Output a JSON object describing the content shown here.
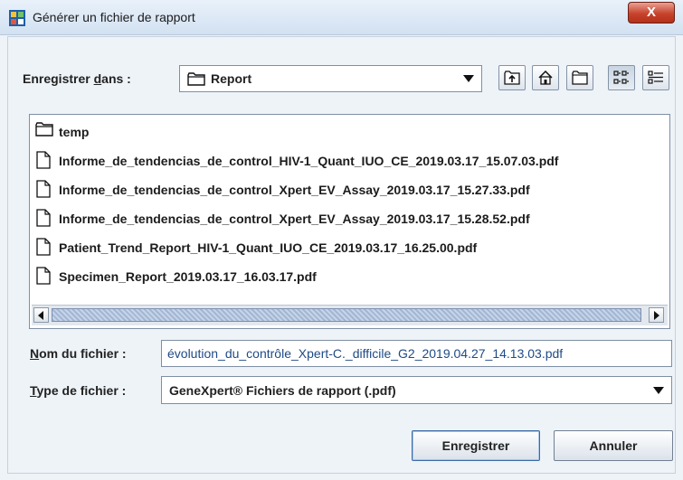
{
  "window": {
    "title": "Générer un fichier de rapport",
    "close_label": "X"
  },
  "lookin": {
    "label_pre": "Enregistrer ",
    "label_mnemonic": "d",
    "label_post": "ans :",
    "value": "Report"
  },
  "toolbar": {
    "buttons": [
      {
        "name": "up-folder-button",
        "icon": "folder-up-icon"
      },
      {
        "name": "home-button",
        "icon": "home-icon"
      },
      {
        "name": "new-folder-button",
        "icon": "new-folder-icon"
      },
      {
        "name": "list-view-button",
        "icon": "list-view-icon"
      },
      {
        "name": "details-view-button",
        "icon": "details-view-icon"
      }
    ]
  },
  "files": [
    {
      "name": "temp",
      "type": "folder"
    },
    {
      "name": "Informe_de_tendencias_de_control_HIV-1_Quant_IUO_CE_2019.03.17_15.07.03.pdf",
      "type": "file"
    },
    {
      "name": "Informe_de_tendencias_de_control_Xpert_EV_Assay_2019.03.17_15.27.33.pdf",
      "type": "file"
    },
    {
      "name": "Informe_de_tendencias_de_control_Xpert_EV_Assay_2019.03.17_15.28.52.pdf",
      "type": "file"
    },
    {
      "name": "Patient_Trend_Report_HIV-1_Quant_IUO_CE_2019.03.17_16.25.00.pdf",
      "type": "file"
    },
    {
      "name": "Specimen_Report_2019.03.17_16.03.17.pdf",
      "type": "file"
    }
  ],
  "filename": {
    "label_mnemonic": "N",
    "label_rest": "om du fichier :",
    "value": "évolution_du_contrôle_Xpert-C._difficile_G2_2019.04.27_14.13.03.pdf"
  },
  "filetype": {
    "label_mnemonic": "T",
    "label_rest": "ype de fichier :",
    "value": "GeneXpert® Fichiers de rapport (.pdf)"
  },
  "buttons": {
    "save": "Enregistrer",
    "cancel": "Annuler"
  }
}
